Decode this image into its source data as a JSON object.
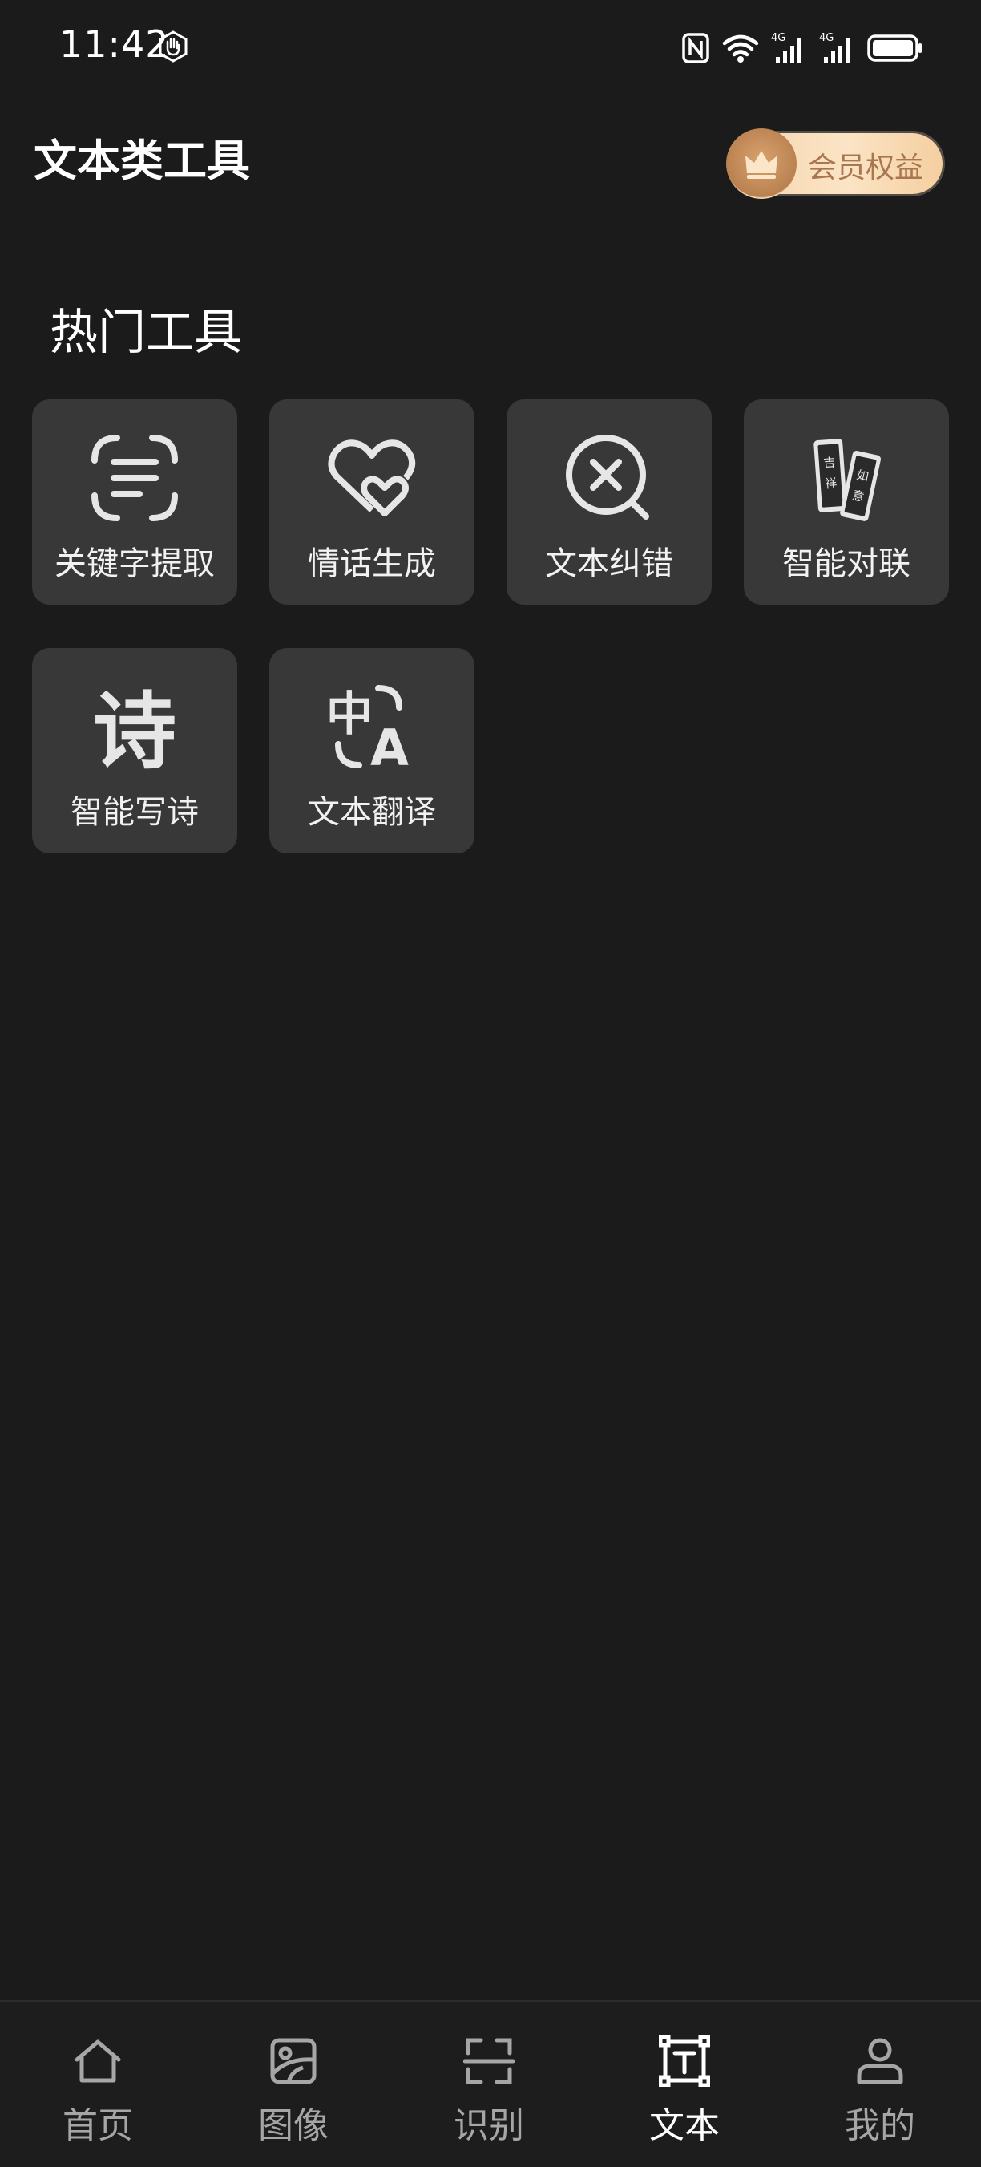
{
  "status_bar": {
    "time": "11:42",
    "icons": [
      "hand-icon",
      "nfc-icon",
      "wifi-icon",
      "signal-4g-icon",
      "signal-4g-icon",
      "battery-icon"
    ],
    "network_labels": [
      "4G",
      "4G"
    ]
  },
  "header": {
    "title": "文本类工具",
    "vip_label": "会员权益",
    "vip_icon": "crown-icon"
  },
  "section": {
    "title": "热门工具"
  },
  "tools": [
    {
      "label": "关键字提取",
      "icon": "text-scan-icon"
    },
    {
      "label": "情话生成",
      "icon": "hearts-icon"
    },
    {
      "label": "文本纠错",
      "icon": "error-search-icon"
    },
    {
      "label": "智能对联",
      "icon": "couplet-icon",
      "couplet_chars": [
        "吉",
        "祥",
        "如",
        "意"
      ]
    },
    {
      "label": "智能写诗",
      "icon": "poem-icon",
      "glyph": "诗"
    },
    {
      "label": "文本翻译",
      "icon": "translate-icon",
      "glyph_zh": "中",
      "glyph_en": "A"
    }
  ],
  "bottom_nav": {
    "items": [
      {
        "label": "首页",
        "icon": "home-icon",
        "active": false
      },
      {
        "label": "图像",
        "icon": "image-icon",
        "active": false
      },
      {
        "label": "识别",
        "icon": "scan-icon",
        "active": false
      },
      {
        "label": "文本",
        "icon": "text-icon",
        "active": true
      },
      {
        "label": "我的",
        "icon": "user-icon",
        "active": false
      }
    ]
  },
  "colors": {
    "background": "#1b1b1b",
    "tile": "#383838",
    "vip_gold": "#f6d5ad",
    "nav_inactive": "#a6a6a6",
    "nav_active": "#ffffff"
  }
}
